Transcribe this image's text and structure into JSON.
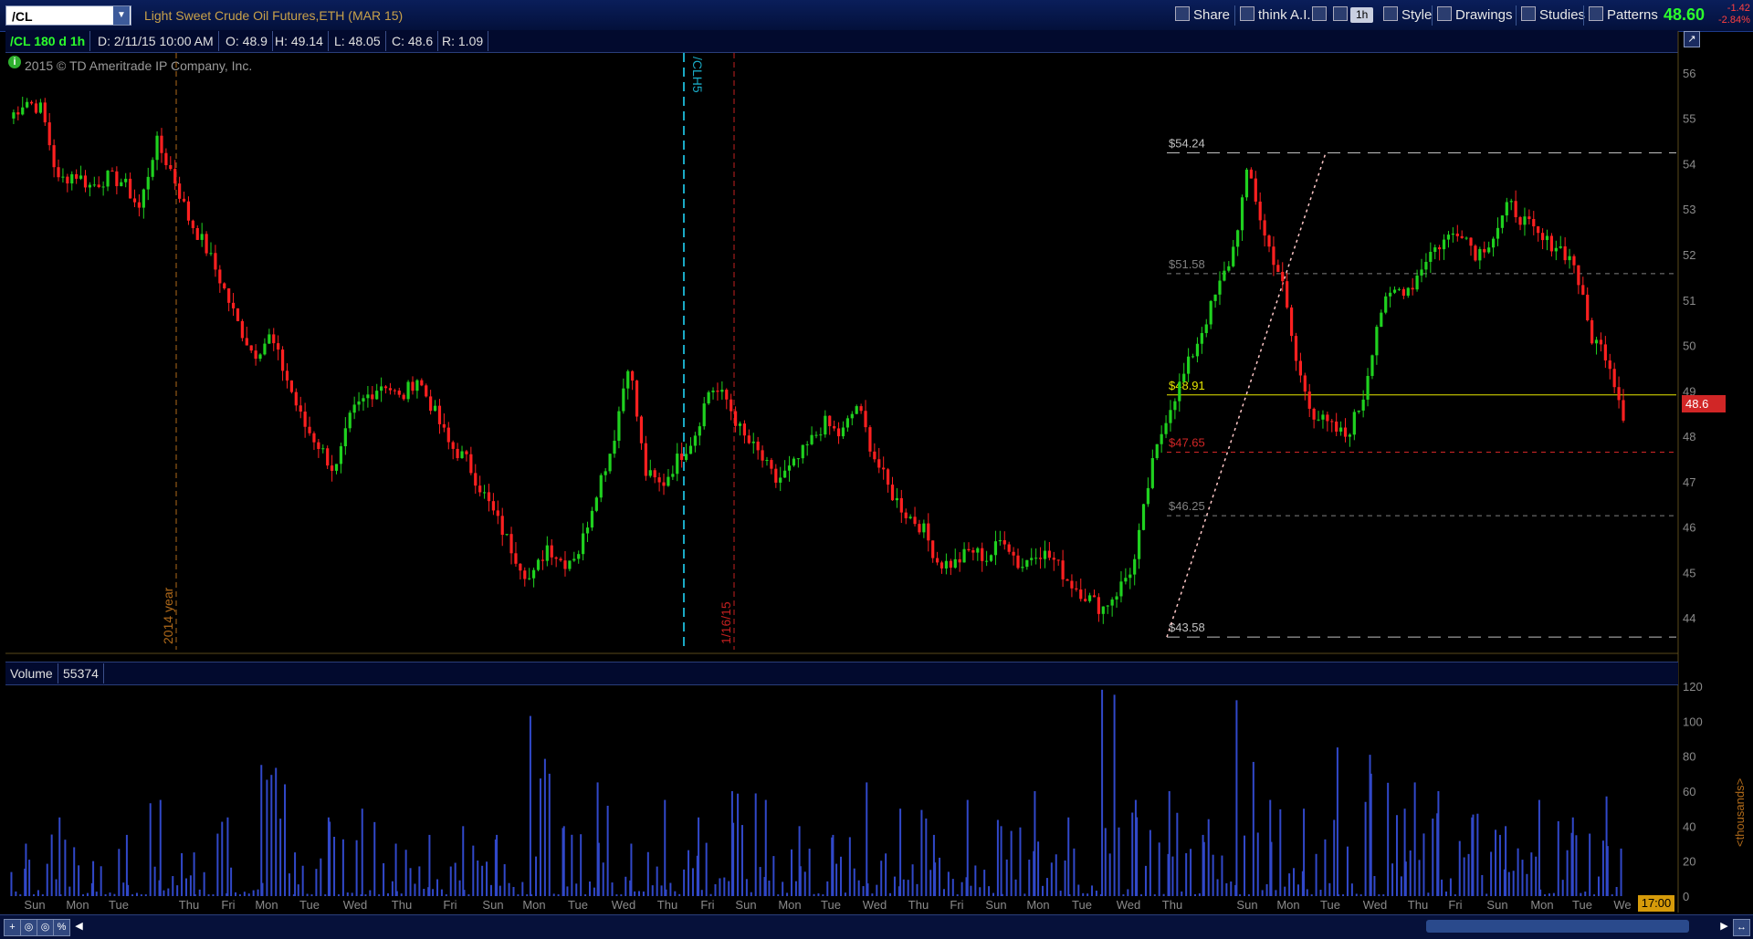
{
  "toolbar": {
    "symbol": "/CL",
    "title": "Light Sweet Crude Oil Futures,ETH (MAR 15)",
    "share_label": "Share",
    "thinkai_label": "think A.I.",
    "timeframe_label": "1h",
    "style_label": "Style",
    "drawings_label": "Drawings",
    "studies_label": "Studies",
    "patterns_label": "Patterns",
    "last_price": "48.60",
    "net_change": "-1.42",
    "pct_change": "-2.84%"
  },
  "info": {
    "symbol_period": "/CL 180 d 1h",
    "date": "D: 2/11/15 10:00 AM",
    "open": "O: 48.9",
    "high": "H: 49.14",
    "low": "L: 48.05",
    "close": "C: 48.6",
    "range": "R: 1.09",
    "copyright": "2015 © TD Ameritrade IP Company, Inc."
  },
  "volume": {
    "label": "Volume",
    "value": "55374",
    "unit_label": "<thousands>"
  },
  "price_badge": "48.6",
  "time_badge": "17:00",
  "colors": {
    "up": "#1fd11f",
    "down": "#ff2020",
    "volume": "#3148c9",
    "fib_top": "#c0c0c0",
    "fib_mid": "#808080",
    "fib_yellow": "#e6e600",
    "fib_red": "#d12626"
  },
  "chart_data": {
    "type": "candlestick",
    "price_axis": {
      "ticks": [
        44,
        45,
        46,
        47,
        48,
        49,
        50,
        51,
        52,
        53,
        54,
        55,
        56
      ],
      "ylim": [
        43.3,
        56.4
      ]
    },
    "volume_axis": {
      "ticks": [
        0,
        20,
        40,
        60,
        80,
        100,
        120
      ],
      "ylim": [
        0,
        120
      ]
    },
    "x_labels": [
      "Sun",
      "Mon",
      "Tue",
      "Thu",
      "Fri",
      "Mon",
      "Tue",
      "Wed",
      "Thu",
      "Fri",
      "Sun",
      "Mon",
      "Tue",
      "Wed",
      "Thu",
      "Fri",
      "Sun",
      "Mon",
      "Tue",
      "Wed",
      "Thu",
      "Fri",
      "Sun",
      "Mon",
      "Tue",
      "Wed",
      "Thu",
      "Sun",
      "Mon",
      "Tue",
      "Wed",
      "Thu",
      "Fri",
      "Sun",
      "Mon",
      "Tue",
      "We"
    ],
    "vertical_markers": [
      {
        "label": "2014 year",
        "color": "#b06a1a"
      },
      {
        "label": "/CLH5",
        "color": "#1aa9c4"
      },
      {
        "label": "1/16/15",
        "color": "#c42020"
      }
    ],
    "fib_levels": [
      {
        "label": "$54.24",
        "value": 54.24
      },
      {
        "label": "$51.58",
        "value": 51.58
      },
      {
        "label": "$48.91",
        "value": 48.91
      },
      {
        "label": "$47.65",
        "value": 47.65
      },
      {
        "label": "$46.25",
        "value": 46.25
      },
      {
        "label": "$43.58",
        "value": 43.58
      }
    ],
    "price_path": [
      55.0,
      55.4,
      55.2,
      53.6,
      53.8,
      53.5,
      53.7,
      53.6,
      53.0,
      54.5,
      53.8,
      52.8,
      52.2,
      51.4,
      50.5,
      49.8,
      50.2,
      49.3,
      48.3,
      47.8,
      47.2,
      48.5,
      48.9,
      49.2,
      48.8,
      49.3,
      48.6,
      47.8,
      47.5,
      46.8,
      46.1,
      45.4,
      44.8,
      45.6,
      45.2,
      45.5,
      46.8,
      47.8,
      49.7,
      47.2,
      46.9,
      47.5,
      48.0,
      49.1,
      48.8,
      48.0,
      47.6,
      47.0,
      47.3,
      47.8,
      48.3,
      48.0,
      48.7,
      47.6,
      46.8,
      46.3,
      46.0,
      45.2,
      45.2,
      45.5,
      45.3,
      45.8,
      45.1,
      45.5,
      45.3,
      44.8,
      44.5,
      44.2,
      44.6,
      45.2,
      47.2,
      48.5,
      49.3,
      50.2,
      51.1,
      52.0,
      53.9,
      52.4,
      51.5,
      49.5,
      48.5,
      48.2,
      48.0,
      48.8,
      50.7,
      51.2,
      51.3,
      52.0,
      52.3,
      52.6,
      52.0,
      52.4,
      53.1,
      52.7,
      52.3,
      52.2,
      51.8,
      50.2,
      49.8,
      48.5
    ],
    "volume_peaks": [
      30,
      45,
      20,
      35,
      55,
      25,
      45,
      75,
      25,
      45,
      50,
      30,
      35,
      40,
      35,
      103,
      40,
      65,
      30,
      55,
      45,
      60,
      55,
      40,
      35,
      65,
      50,
      35,
      55,
      40,
      60,
      45,
      118,
      55,
      60,
      35,
      112,
      55,
      50,
      85,
      70,
      50,
      60,
      45,
      40,
      55,
      45,
      57
    ]
  }
}
